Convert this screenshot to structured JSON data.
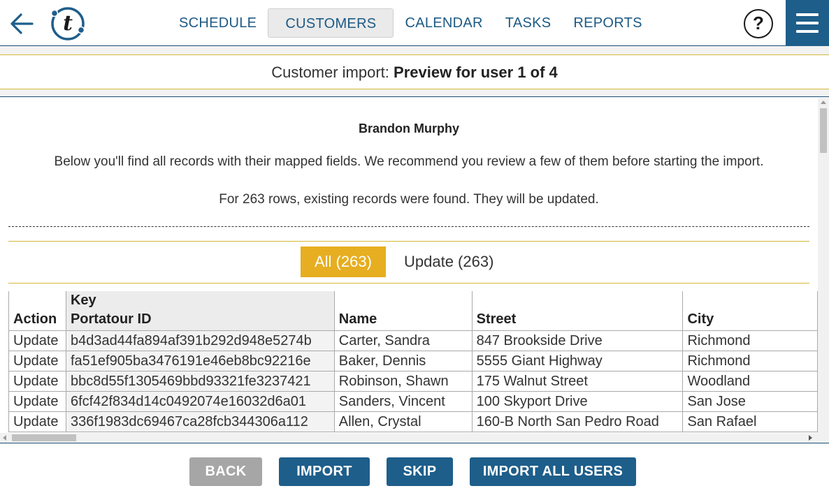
{
  "nav": {
    "items": [
      {
        "label": "SCHEDULE",
        "active": false
      },
      {
        "label": "CUSTOMERS",
        "active": true
      },
      {
        "label": "CALENDAR",
        "active": false
      },
      {
        "label": "TASKS",
        "active": false
      },
      {
        "label": "REPORTS",
        "active": false
      }
    ],
    "help_label": "?",
    "colors": {
      "brand": "#1e5e8a",
      "accent": "#e6ae20"
    }
  },
  "title": {
    "prefix": "Customer import: ",
    "bold": "Preview for user 1 of 4"
  },
  "content": {
    "user_name": "Brandon Murphy",
    "description": "Below you'll find all records with their mapped fields. We recommend you review a few of them before starting the import.",
    "info": "For 263 rows, existing records were found. They will be updated."
  },
  "filters": {
    "all": "All (263)",
    "update": "Update (263)"
  },
  "table": {
    "headers": {
      "action": "Action",
      "key_top": "Key",
      "key": "Portatour ID",
      "name": "Name",
      "street": "Street",
      "city": "City"
    },
    "rows": [
      {
        "action": "Update",
        "id": "b4d3ad44fa894af391b292d948e5274b",
        "name": "Carter, Sandra",
        "street": "847 Brookside Drive",
        "city": "Richmond"
      },
      {
        "action": "Update",
        "id": "fa51ef905ba3476191e46eb8bc92216e",
        "name": "Baker, Dennis",
        "street": "5555 Giant Highway",
        "city": "Richmond"
      },
      {
        "action": "Update",
        "id": "bbc8d55f1305469bbd93321fe3237421",
        "name": "Robinson, Shawn",
        "street": "175 Walnut Street",
        "city": "Woodland"
      },
      {
        "action": "Update",
        "id": "6fcf42f834d14c0492074e16032d6a01",
        "name": "Sanders, Vincent",
        "street": "100 Skyport Drive",
        "city": "San Jose"
      },
      {
        "action": "Update",
        "id": "336f1983dc69467ca28fcb344306a112",
        "name": "Allen, Crystal",
        "street": "160-B North San Pedro Road",
        "city": "San Rafael"
      }
    ]
  },
  "footer": {
    "back": "BACK",
    "import": "IMPORT",
    "skip": "SKIP",
    "import_all": "IMPORT ALL USERS"
  }
}
